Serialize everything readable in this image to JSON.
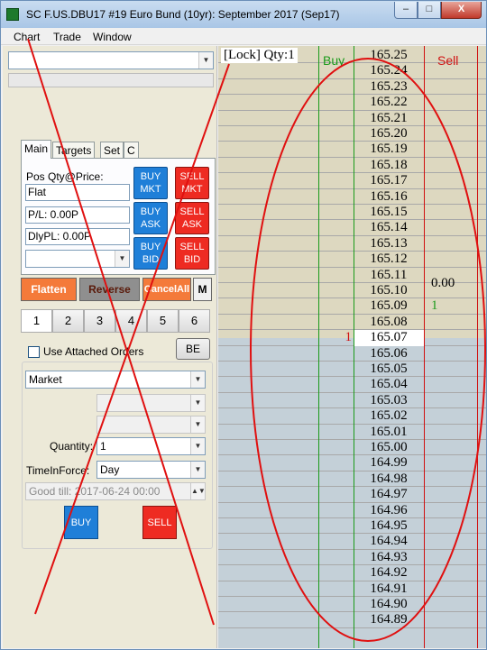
{
  "window": {
    "title": "SC F.US.DBU17  #19  Euro Bund (10yr): September 2017 (Sep17)",
    "min_label": "–",
    "max_label": "□",
    "close_label": "X"
  },
  "menu": [
    "Chart",
    "Trade",
    "Window"
  ],
  "account_combo": {
    "value": ""
  },
  "tabs": [
    "Main",
    "Targets",
    "Set",
    "C"
  ],
  "main": {
    "pos_label": "Pos Qty@Price:",
    "pos_value": "Flat",
    "pl_value": "P/L: 0.00P",
    "dlypl_value": "DlyPL: 0.00P",
    "blank_combo": ""
  },
  "order_buttons": {
    "buy_mkt": [
      "BUY",
      "MKT"
    ],
    "sell_mkt": [
      "SELL",
      "MKT"
    ],
    "buy_ask": [
      "BUY",
      "ASK"
    ],
    "sell_ask": [
      "SELL",
      "ASK"
    ],
    "buy_bid": [
      "BUY",
      "BID"
    ],
    "sell_bid": [
      "SELL",
      "BID"
    ]
  },
  "actions": {
    "flatten": "Flatten",
    "reverse": "Reverse",
    "cancel_all": "CancelAll",
    "m": "M"
  },
  "number_buttons": [
    "1",
    "2",
    "3",
    "4",
    "5",
    "6"
  ],
  "attached_orders": {
    "label": "Use Attached Orders",
    "checked": false,
    "be_button": "BE"
  },
  "order_entry": {
    "order_type": "Market",
    "quantity_label": "Quantity:",
    "quantity": "1",
    "tif_label": "TimeInForce:",
    "tif": "Day",
    "good_till": "Good till: 2017-06-24 00:00",
    "buy_button": "BUY",
    "sell_button": "SELL"
  },
  "ladder": {
    "lock_label": "[Lock] Qty:1",
    "buy_header": "Buy",
    "sell_header": "Sell",
    "prices": [
      "165.25",
      "165.24",
      "165.23",
      "165.22",
      "165.21",
      "165.20",
      "165.19",
      "165.18",
      "165.17",
      "165.16",
      "165.15",
      "165.14",
      "165.13",
      "165.12",
      "165.11",
      "165.10",
      "165.09",
      "165.08",
      "165.07",
      "165.06",
      "165.05",
      "165.04",
      "165.03",
      "165.02",
      "165.01",
      "165.00",
      "164.99",
      "164.98",
      "164.97",
      "164.96",
      "164.95",
      "164.94",
      "164.93",
      "164.92",
      "164.91",
      "164.90",
      "164.89"
    ],
    "current_price": "165.07",
    "bid_qty": "1",
    "ask_qty": "1",
    "pnl": "0.00",
    "colors": {
      "buy": "#1a9a1a",
      "sell": "#d01010",
      "upper_bg": "#ddd8c0",
      "lower_bg": "#c4d0d8"
    }
  },
  "annotations": {
    "color": "#e01010"
  }
}
